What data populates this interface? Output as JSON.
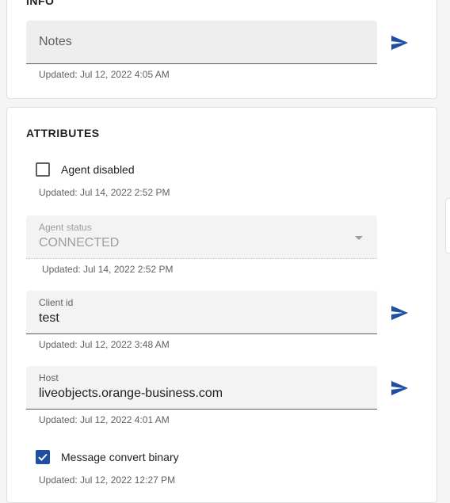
{
  "info": {
    "title": "INFO",
    "notes": {
      "placeholder": "Notes",
      "updated": "Updated: Jul 12, 2022 4:05 AM"
    }
  },
  "attributes": {
    "title": "ATTRIBUTES",
    "agent_disabled": {
      "label": "Agent disabled",
      "checked": false,
      "updated": "Updated: Jul 14, 2022 2:52 PM"
    },
    "agent_status": {
      "label": "Agent status",
      "value": "CONNECTED",
      "updated": "Updated: Jul 14, 2022 2:52 PM"
    },
    "client_id": {
      "label": "Client id",
      "value": "test",
      "updated": "Updated: Jul 12, 2022 3:48 AM"
    },
    "host": {
      "label": "Host",
      "value": "liveobjects.orange-business.com",
      "updated": "Updated: Jul 12, 2022 4:01 AM"
    },
    "message_convert_binary": {
      "label": "Message convert binary",
      "checked": true,
      "updated": "Updated: Jul 12, 2022 12:27 PM"
    }
  },
  "icons": {
    "send": "send-icon",
    "check": "check-icon",
    "dropdown": "chevron-down-icon"
  },
  "colors": {
    "accent": "#1e4fa3",
    "field_bg": "#eeeeee",
    "muted_text": "#616161"
  }
}
